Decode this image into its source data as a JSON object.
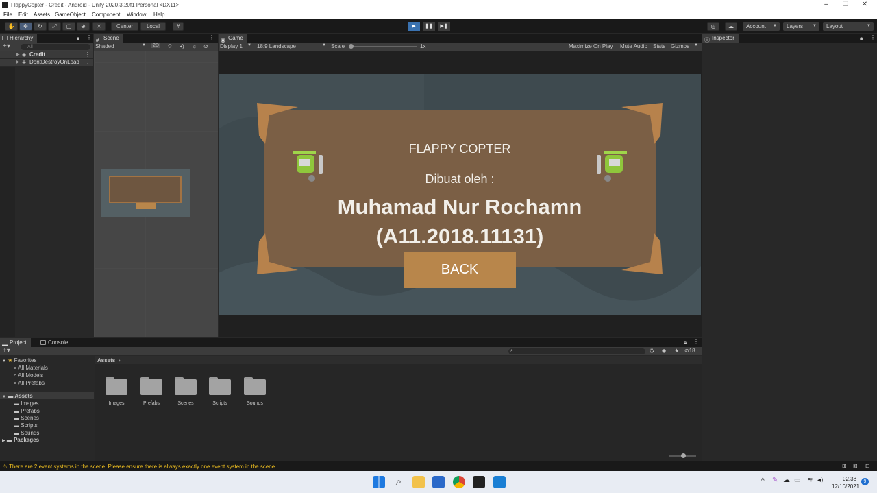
{
  "window": {
    "title": "FlappyCopter - Credit - Android - Unity 2020.3.20f1 Personal <DX11>"
  },
  "menu": [
    "File",
    "Edit",
    "Assets",
    "GameObject",
    "Component",
    "Window",
    "Help"
  ],
  "toolbar": {
    "pivot_center": "Center",
    "pivot_local": "Local",
    "account": "Account",
    "layers": "Layers",
    "layout": "Layout"
  },
  "hierarchy": {
    "tab": "Hierarchy",
    "search_placeholder": "All",
    "items": [
      "Credit",
      "DontDestroyOnLoad"
    ]
  },
  "scene": {
    "tab": "Scene",
    "shading": "Shaded",
    "mode_2d": "2D"
  },
  "game": {
    "tab": "Game",
    "display": "Display 1",
    "aspect": "18:9 Landscape",
    "scale_label": "Scale",
    "scale_value": "1x",
    "maximize": "Maximize On Play",
    "mute": "Mute Audio",
    "stats": "Stats",
    "gizmos": "Gizmos"
  },
  "credit_screen": {
    "game_title": "FLAPPY COPTER",
    "made_by": "Dibuat oleh :",
    "author": "Muhamad Nur Rochamn",
    "student_id": "(A11.2018.11131)",
    "back_button": "BACK"
  },
  "inspector": {
    "tab": "Inspector"
  },
  "project": {
    "tab_project": "Project",
    "tab_console": "Console",
    "favorites_label": "Favorites",
    "favorites": [
      "All Materials",
      "All Models",
      "All Prefabs"
    ],
    "assets_label": "Assets",
    "asset_folders_tree": [
      "Images",
      "Prefabs",
      "Scenes",
      "Scripts",
      "Sounds"
    ],
    "packages_label": "Packages",
    "breadcrumb": "Assets",
    "asset_folders": [
      "Images",
      "Prefabs",
      "Scenes",
      "Scripts",
      "Sounds"
    ],
    "hidden_count": "18"
  },
  "status": {
    "message": "There are 2 event systems in the scene. Please ensure there is always exactly one event system in the scene"
  },
  "taskbar": {
    "time": "02.38",
    "date": "12/10/2021",
    "notifications": "9"
  },
  "colors": {
    "accent_play": "#3a72b0",
    "warning": "#f0c020",
    "board": "#7b5f45",
    "button": "#b8864b"
  }
}
